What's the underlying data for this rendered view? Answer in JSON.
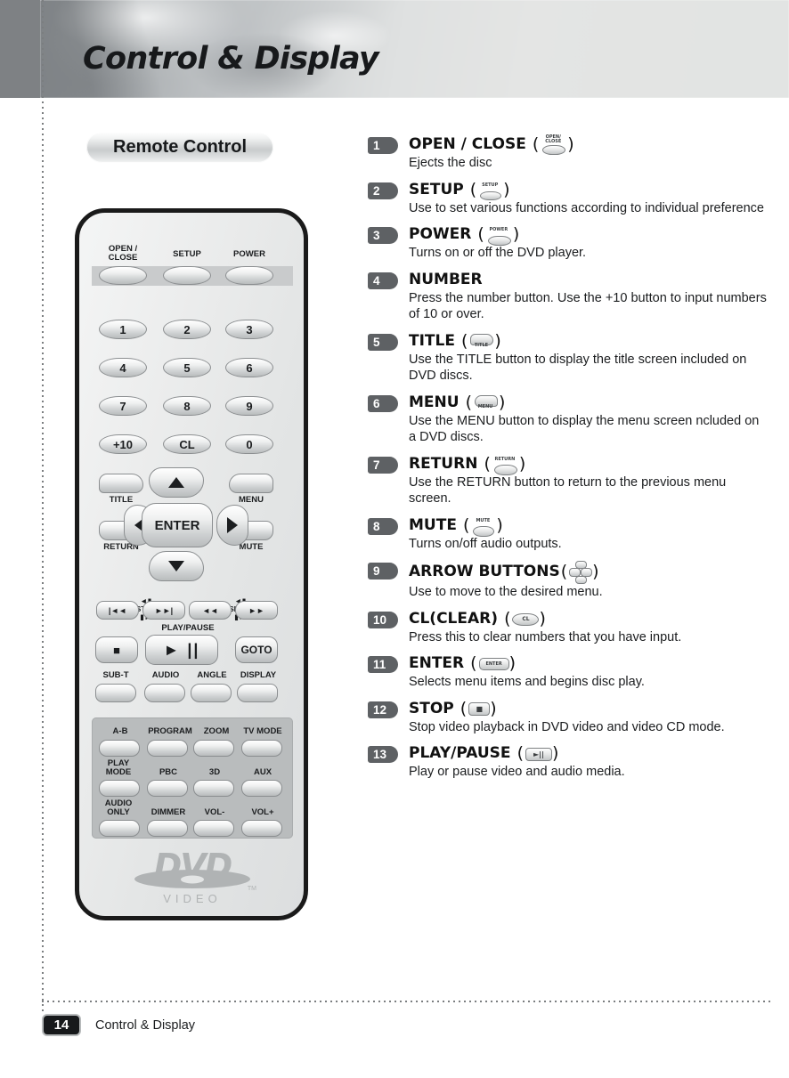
{
  "header": {
    "title": "Control & Display"
  },
  "remote_badge": {
    "label": "Remote Control"
  },
  "remote": {
    "top_row": [
      {
        "label": "OPEN /\nCLOSE"
      },
      {
        "label": "SETUP"
      },
      {
        "label": "POWER"
      }
    ],
    "numpad": [
      [
        "1",
        "2",
        "3"
      ],
      [
        "4",
        "5",
        "6"
      ],
      [
        "7",
        "8",
        "9"
      ],
      [
        "+10",
        "CL",
        "0"
      ]
    ],
    "nav": {
      "title": "TITLE",
      "menu": "MENU",
      "return": "RETURN",
      "mute": "MUTE",
      "enter": "ENTER"
    },
    "transport_headers": {
      "step": "STEP",
      "slow": "SLOW",
      "play_pause": "PLAY/PAUSE"
    },
    "transport": {
      "prev": "|◄◄",
      "next": "►►|",
      "rew": "◄◄",
      "ffwd": "►►",
      "stop": "■",
      "play_pause": "► ||",
      "goto": "GOTO"
    },
    "function_row": [
      "SUB-T",
      "AUDIO",
      "ANGLE",
      "DISPLAY"
    ],
    "panel": [
      [
        "A-B",
        "PROGRAM",
        "ZOOM",
        "TV MODE"
      ],
      [
        "PLAY\nMODE",
        "PBC",
        "3D",
        "AUX"
      ],
      [
        "AUDIO\nONLY",
        "DIMMER",
        "VOL-",
        "VOL+"
      ]
    ],
    "logo": {
      "brand": "DVD",
      "sub": "VIDEO",
      "tm": "TM"
    }
  },
  "legend": [
    {
      "num": "1",
      "title": "OPEN / CLOSE",
      "icon": "open-close-button-icon",
      "icon_caption": "OPEN/\nCLOSE",
      "desc": "Ejects the disc"
    },
    {
      "num": "2",
      "title": "SETUP",
      "icon": "setup-button-icon",
      "icon_caption": "SETUP",
      "desc": "Use to set various functions according to individual preference"
    },
    {
      "num": "3",
      "title": "POWER",
      "icon": "power-button-icon",
      "icon_caption": "POWER",
      "desc": "Turns on or off the DVD player."
    },
    {
      "num": "4",
      "title": "NUMBER",
      "icon": "",
      "icon_caption": "",
      "desc": "Press the number button. Use the +10 button to input numbers of 10 or over."
    },
    {
      "num": "5",
      "title": "TITLE",
      "icon": "title-button-icon",
      "icon_caption": "TITLE",
      "desc": "Use the TITLE button to display the title screen included on DVD discs."
    },
    {
      "num": "6",
      "title": "MENU",
      "icon": "menu-button-icon",
      "icon_caption": "MENU",
      "desc": "Use the MENU button to display the menu screen ncluded on a DVD discs."
    },
    {
      "num": "7",
      "title": "RETURN",
      "icon": "return-button-icon",
      "icon_caption": "RETURN",
      "desc": "Use the RETURN button to return to the previous menu screen."
    },
    {
      "num": "8",
      "title": "MUTE",
      "icon": "mute-button-icon",
      "icon_caption": "MUTE",
      "desc": "Turns on/off audio outputs."
    },
    {
      "num": "9",
      "title": "ARROW BUTTONS",
      "icon": "arrow-buttons-icon",
      "icon_caption": "",
      "desc": "Use to move to the desired menu."
    },
    {
      "num": "10",
      "title": "CL(CLEAR)",
      "icon": "cl-button-icon",
      "icon_caption": "CL",
      "desc": "Press this to clear numbers that you have input."
    },
    {
      "num": "11",
      "title": "ENTER",
      "icon": "enter-button-icon",
      "icon_caption": "ENTER",
      "desc": "Selects menu items and begins disc play."
    },
    {
      "num": "12",
      "title": "STOP",
      "icon": "stop-button-icon",
      "icon_caption": "■",
      "desc": "Stop video playback in DVD video and video CD mode."
    },
    {
      "num": "13",
      "title": "PLAY/PAUSE",
      "icon": "play-pause-button-icon",
      "icon_caption": "►||",
      "desc": "Play or pause video and audio media."
    }
  ],
  "footer": {
    "page": "14",
    "section": "Control & Display"
  }
}
